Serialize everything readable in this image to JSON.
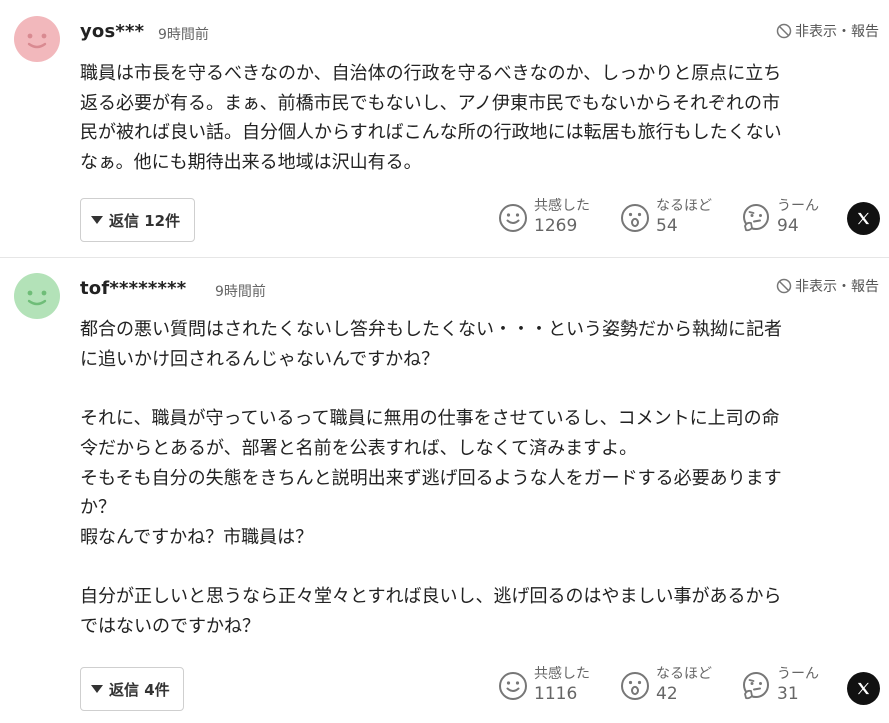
{
  "comments": [
    {
      "username": "yos***",
      "time": "9時間前",
      "hide_label": "非表示・報告",
      "body": [
        [
          "職員は市長を守るべきなのか、自治体の行政を守るべきなのか、しっかりと原点に立ち",
          "返る必要が有る。まぁ、前橋市民でもないし、アノ伊東市民でもないからそれぞれの市",
          "民が被れば良い話。自分個人からすればこんな所の行政地には転居も旅行もしたくない",
          "なぁ。他にも期待出来る地域は沢山有る。"
        ]
      ],
      "reply_label": "返信 12件",
      "reactions": [
        {
          "label": "共感した",
          "count": "1269",
          "icon": "smile-face-icon"
        },
        {
          "label": "なるほど",
          "count": "54",
          "icon": "surprised-face-icon"
        },
        {
          "label": "うーん",
          "count": "94",
          "icon": "thinking-face-icon"
        }
      ],
      "share_icon": "x-logo-icon",
      "avatar_color": "#f2b8bc"
    },
    {
      "username": "tof********",
      "time": "9時間前",
      "hide_label": "非表示・報告",
      "body": [
        [
          "都合の悪い質問はされたくないし答弁もしたくない・・・という姿勢だから執拗に記者",
          "に追いかけ回されるんじゃないんですかね？"
        ],
        [
          "それに、職員が守っているって職員に無用の仕事をさせているし、コメントに上司の命",
          "令だからとあるが、部署と名前を公表すれば、しなくて済みますよ。",
          "そもそも自分の失態をきちんと説明出来ず逃げ回るような人をガードする必要あります",
          "か？",
          "暇なんですかね？市職員は？"
        ],
        [
          "自分が正しいと思うなら正々堂々とすれば良いし、逃げ回るのはやましい事があるから",
          "ではないのですかね？"
        ]
      ],
      "reply_label": "返信 4件",
      "reactions": [
        {
          "label": "共感した",
          "count": "1116",
          "icon": "smile-face-icon"
        },
        {
          "label": "なるほど",
          "count": "42",
          "icon": "surprised-face-icon"
        },
        {
          "label": "うーん",
          "count": "31",
          "icon": "thinking-face-icon"
        }
      ],
      "share_icon": "x-logo-icon",
      "avatar_color": "#b3e2b8"
    }
  ]
}
